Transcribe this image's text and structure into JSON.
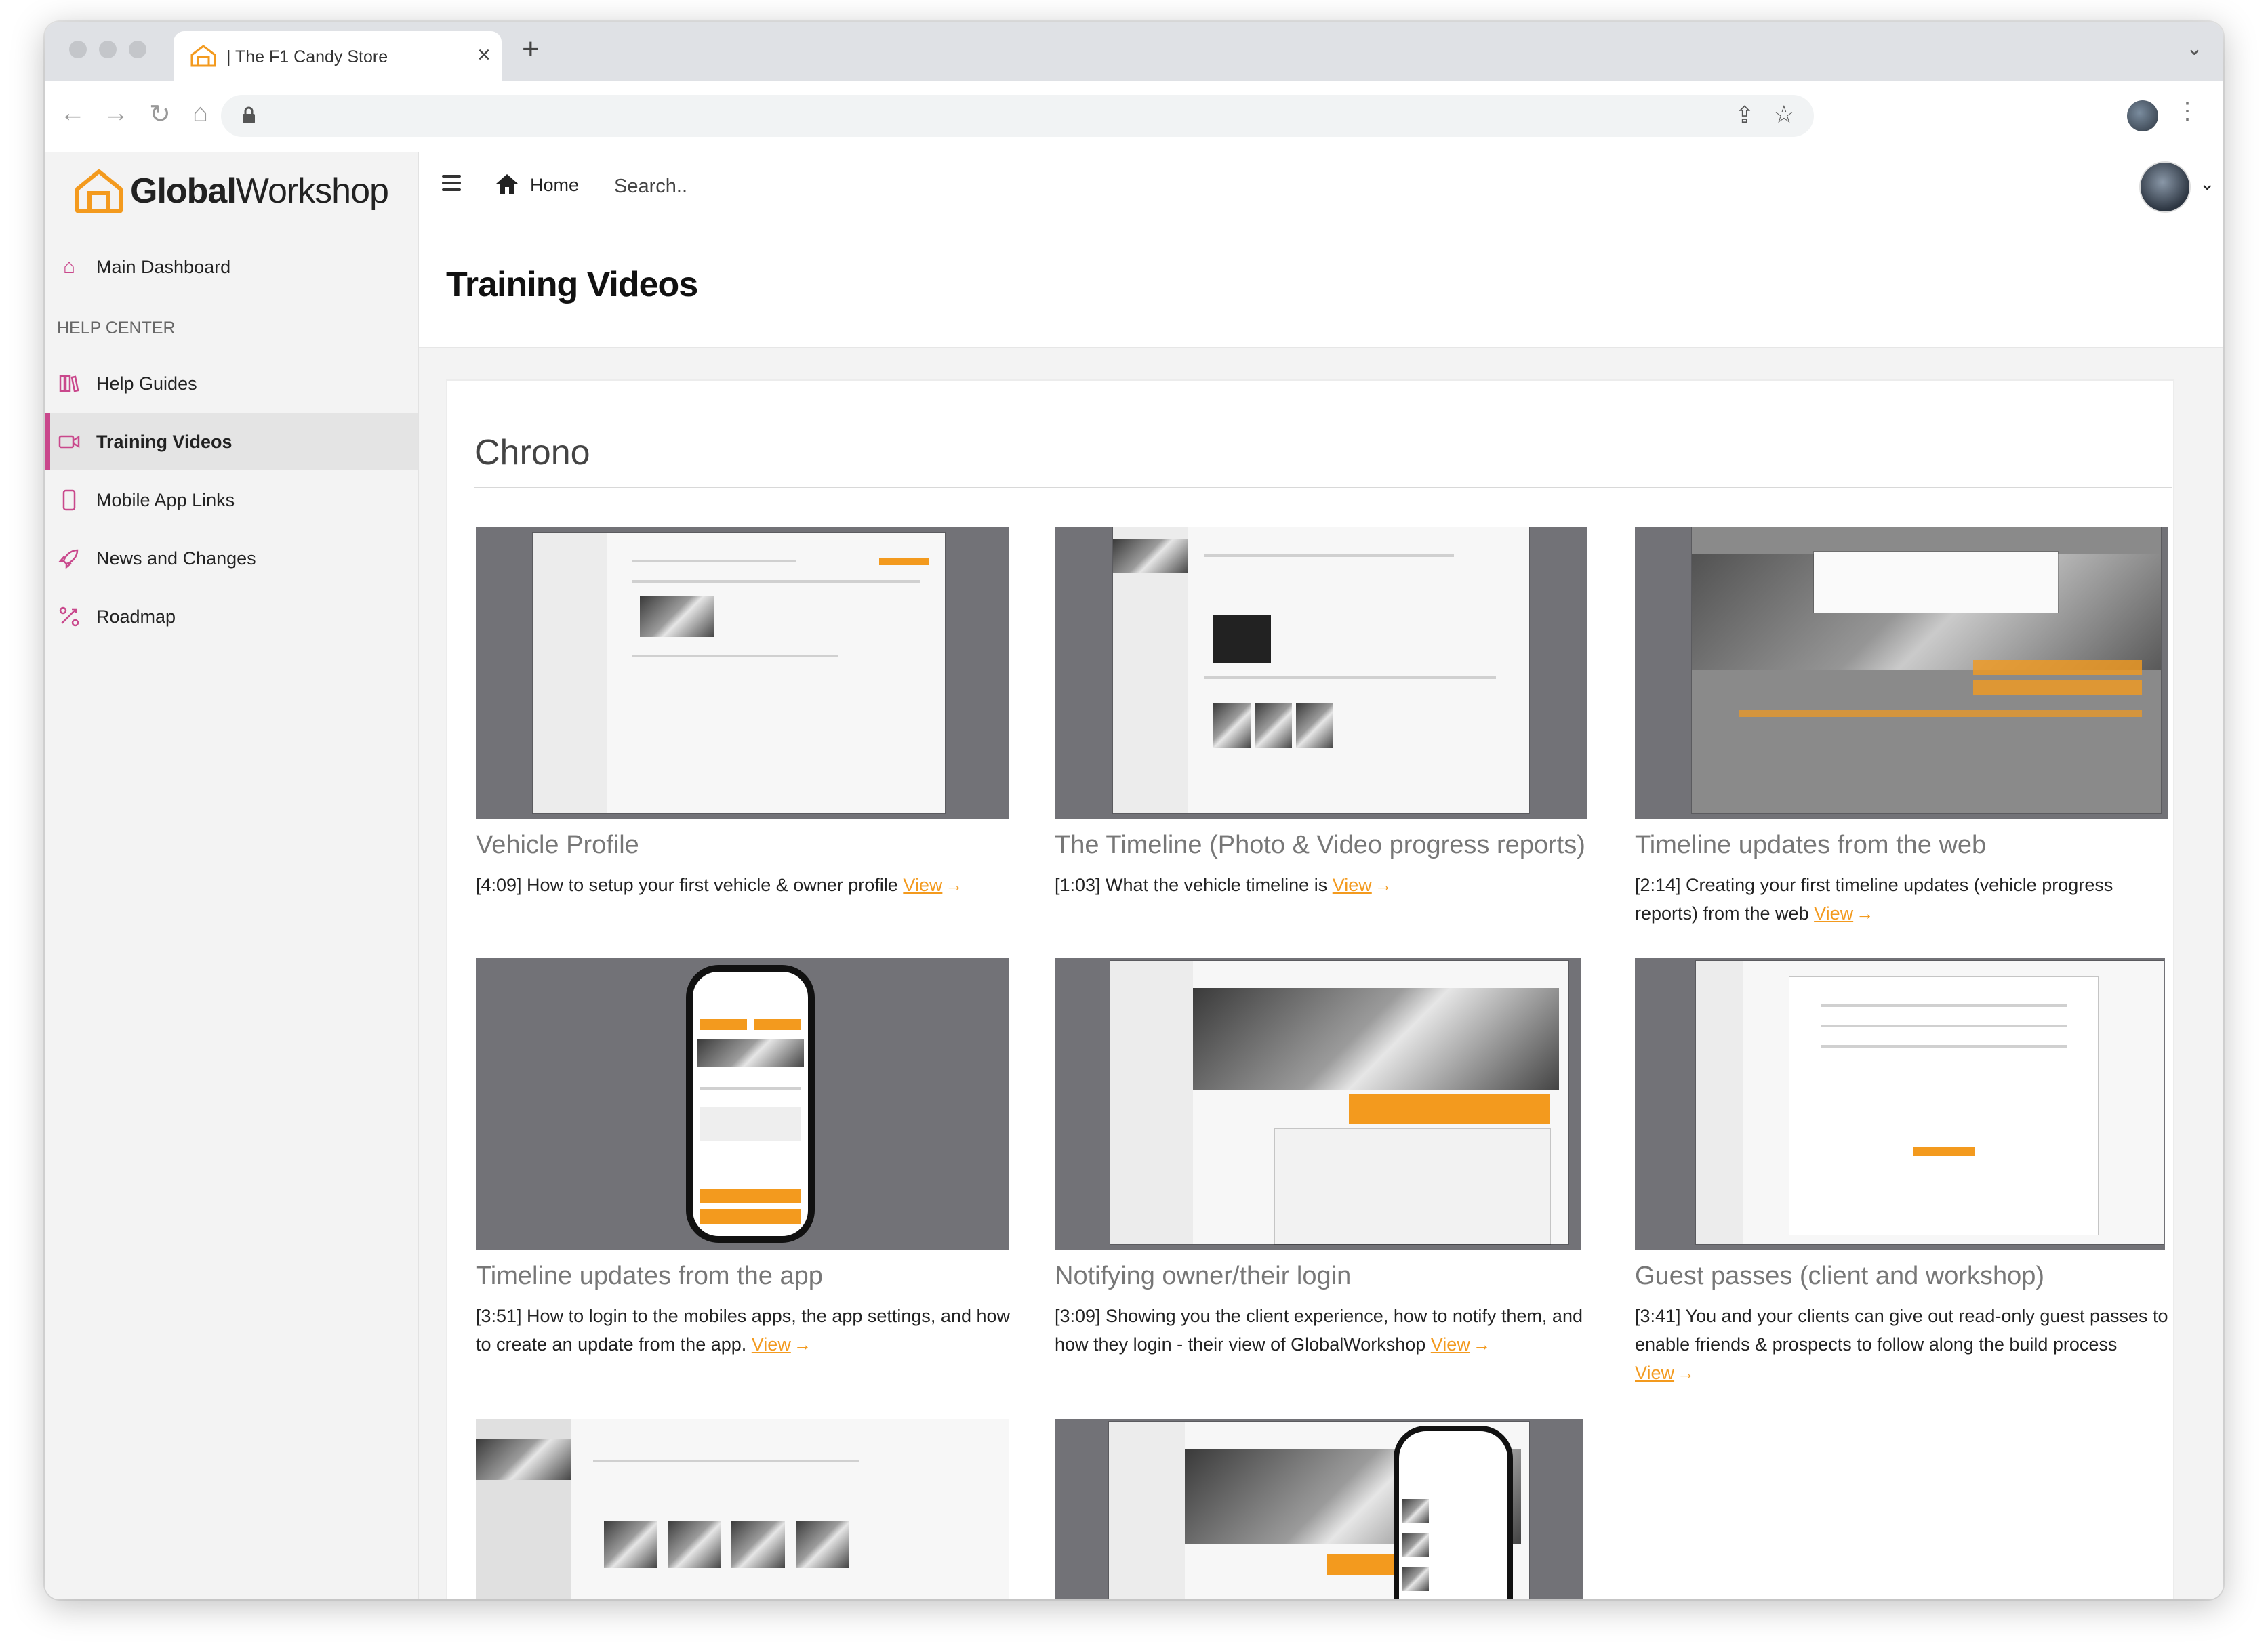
{
  "browser": {
    "tab_title": "| The F1 Candy Store",
    "tab_close": "×",
    "new_tab": "+",
    "back_icon": "arrow-left-icon",
    "forward_icon": "arrow-right-icon",
    "reload_icon": "reload-icon",
    "home_icon": "home-icon"
  },
  "app": {
    "brand_bold": "Global",
    "brand_light": "Workshop",
    "accent_color": "#f39a1e",
    "sidebar_accent": "#c9488c"
  },
  "sidebar": {
    "main_dashboard": "Main Dashboard",
    "section_heading": "HELP CENTER",
    "items": [
      {
        "label": "Help Guides",
        "icon": "books-icon"
      },
      {
        "label": "Training Videos",
        "icon": "video-icon",
        "active": true
      },
      {
        "label": "Mobile App Links",
        "icon": "phone-icon"
      },
      {
        "label": "News and Changes",
        "icon": "rocket-icon"
      },
      {
        "label": "Roadmap",
        "icon": "roadmap-icon"
      }
    ]
  },
  "topbar": {
    "home_label": "Home",
    "search_placeholder": "Search.."
  },
  "page": {
    "title": "Training Videos",
    "section_title": "Chrono"
  },
  "videos": [
    {
      "title": "Vehicle Profile",
      "desc": "[4:09] How to setup your first vehicle & owner profile",
      "link": "View"
    },
    {
      "title": "The Timeline (Photo & Video progress reports)",
      "desc": "[1:03] What the vehicle timeline is",
      "link": "View"
    },
    {
      "title": "Timeline updates from the web",
      "desc": "[2:14] Creating your first timeline updates (vehicle progress reports) from the web",
      "link": "View"
    },
    {
      "title": "Timeline updates from the app",
      "desc": "[3:51] How to login to the mobiles apps, the app settings, and how to create an update from the app.",
      "link": "View"
    },
    {
      "title": "Notifying owner/their login",
      "desc": "[3:09] Showing you the client experience, how to notify them, and how they login - their view of GlobalWorkshop",
      "link": "View"
    },
    {
      "title": "Guest passes (client and workshop)",
      "desc": "[3:41] You and your clients can give out read-only guest passes to enable friends & prospects to follow along the build process",
      "link": "View"
    }
  ]
}
